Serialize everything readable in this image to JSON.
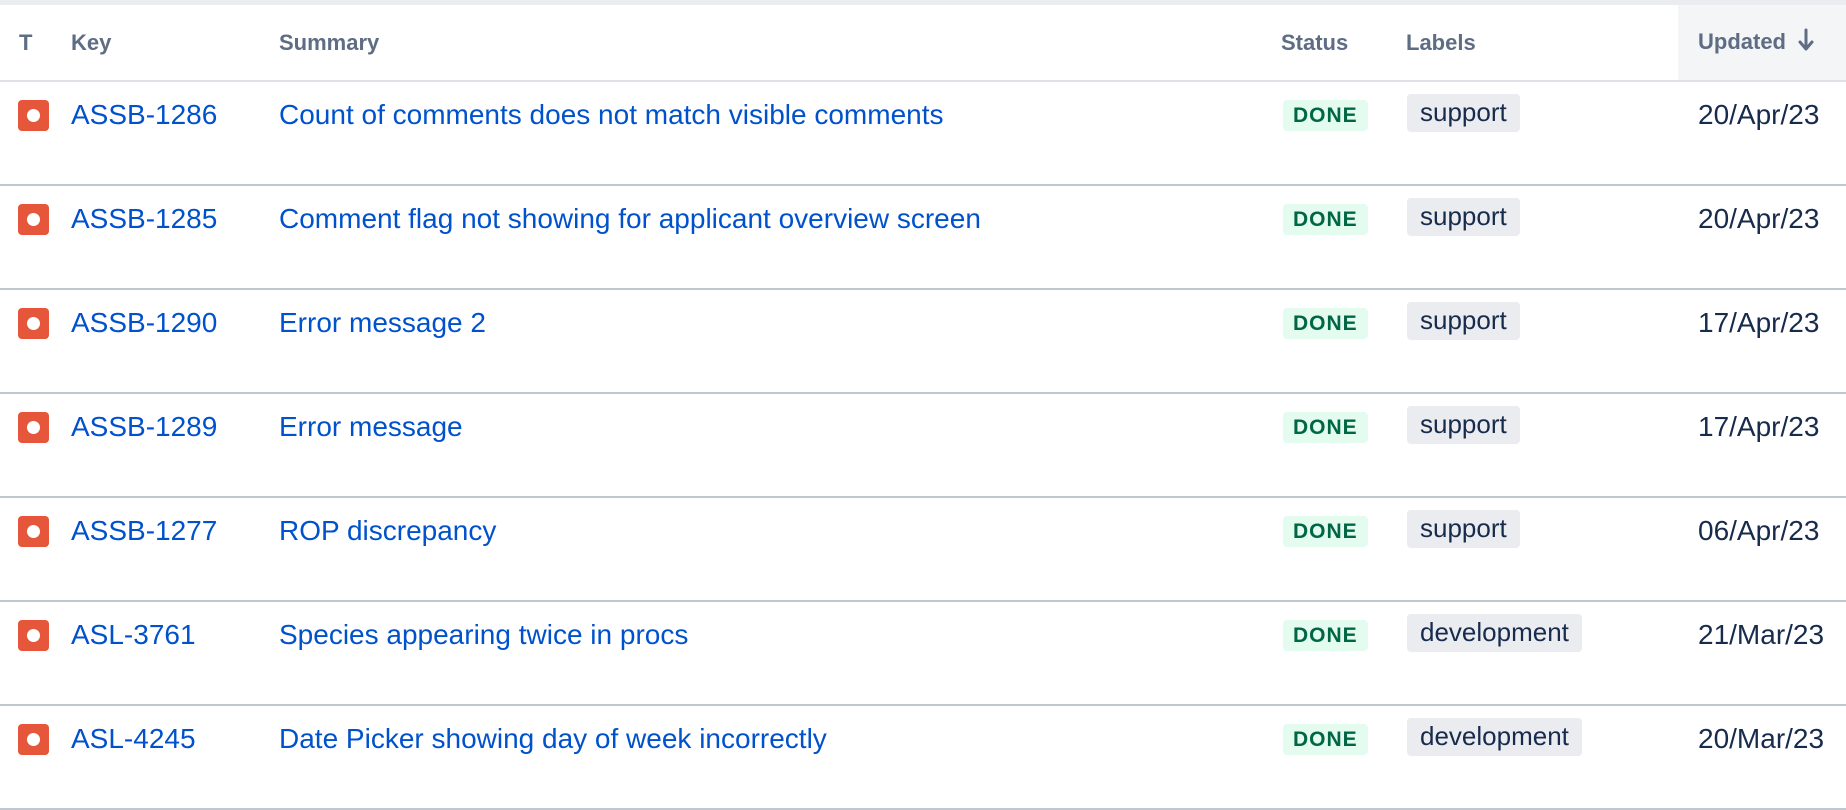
{
  "table": {
    "columns": {
      "type": "T",
      "key": "Key",
      "summary": "Summary",
      "status": "Status",
      "labels": "Labels",
      "updated": "Updated"
    },
    "sort": {
      "column": "Updated",
      "direction": "descending",
      "icon": "arrow-down-icon"
    },
    "rows": [
      {
        "type_icon": "bug-icon",
        "key": "ASSB-1286",
        "summary": "Count of comments does not match visible comments",
        "status": "DONE",
        "label": "support",
        "updated": "20/Apr/23"
      },
      {
        "type_icon": "bug-icon",
        "key": "ASSB-1285",
        "summary": "Comment flag not showing for applicant overview screen",
        "status": "DONE",
        "label": "support",
        "updated": "20/Apr/23"
      },
      {
        "type_icon": "bug-icon",
        "key": "ASSB-1290",
        "summary": "Error message 2",
        "status": "DONE",
        "label": "support",
        "updated": "17/Apr/23"
      },
      {
        "type_icon": "bug-icon",
        "key": "ASSB-1289",
        "summary": "Error message",
        "status": "DONE",
        "label": "support",
        "updated": "17/Apr/23"
      },
      {
        "type_icon": "bug-icon",
        "key": "ASSB-1277",
        "summary": "ROP discrepancy",
        "status": "DONE",
        "label": "support",
        "updated": "06/Apr/23"
      },
      {
        "type_icon": "bug-icon",
        "key": "ASL-3761",
        "summary": "Species appearing twice in procs",
        "status": "DONE",
        "label": "development",
        "updated": "21/Mar/23"
      },
      {
        "type_icon": "bug-icon",
        "key": "ASL-4245",
        "summary": "Date Picker showing day of week incorrectly",
        "status": "DONE",
        "label": "development",
        "updated": "20/Mar/23"
      }
    ]
  },
  "colors": {
    "link": "#0052cc",
    "header_text": "#5e6c84",
    "bug_icon": "#e5563b",
    "status_done_bg": "#e3fcef",
    "status_done_text": "#006644",
    "label_bg": "#ebecf0"
  }
}
